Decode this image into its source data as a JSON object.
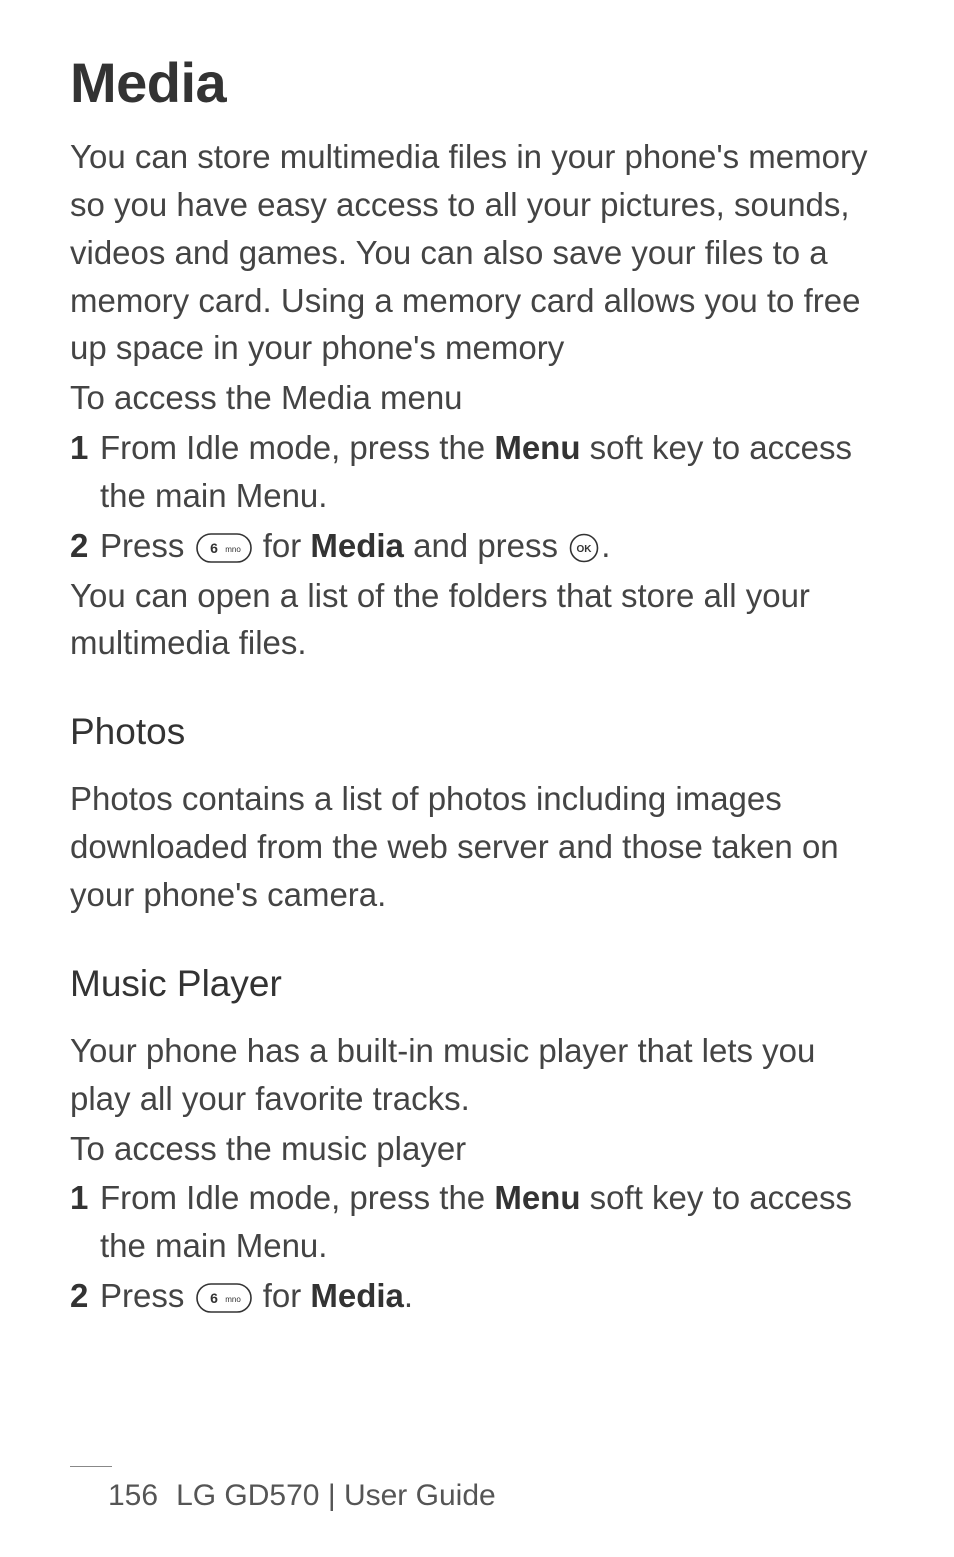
{
  "page_title": "Media",
  "intro_paragraph": "You can store multimedia files in your phone's memory so you have easy access to all your pictures, sounds, videos and games. You can also save your files to a memory card. Using a memory card allows you to free up space in your phone's memory",
  "access_heading": "To access the Media menu",
  "step1_prefix": "From Idle mode, press the ",
  "step1_bold": "Menu",
  "step1_suffix": " soft key to access the main Menu.",
  "step2_prefix": "Press ",
  "step2_mid1": " for ",
  "step2_bold": "Media",
  "step2_mid2": " and press ",
  "step2_suffix": ".",
  "folders_text": "You can open a list of the folders that store all your multimedia files.",
  "photos_heading": "Photos",
  "photos_body": "Photos contains a list of photos including images downloaded from the web server and those taken on your phone's camera.",
  "music_heading": "Music Player",
  "music_body": "Your phone has a built-in music player that lets you play all your favorite tracks.",
  "music_access_heading": "To access the music player",
  "music_step1_prefix": "From Idle mode, press the ",
  "music_step1_bold": "Menu",
  "music_step1_suffix": " soft key to access the main Menu.",
  "music_step2_prefix": "Press ",
  "music_step2_mid": " for ",
  "music_step2_bold": "Media",
  "music_step2_suffix": ".",
  "footer_page": "156",
  "footer_device": "LG GD570",
  "footer_divider": "  |  ",
  "footer_guide": "User Guide",
  "icons": {
    "six_key": "6-mno-key-icon",
    "ok_key": "ok-key-icon"
  }
}
